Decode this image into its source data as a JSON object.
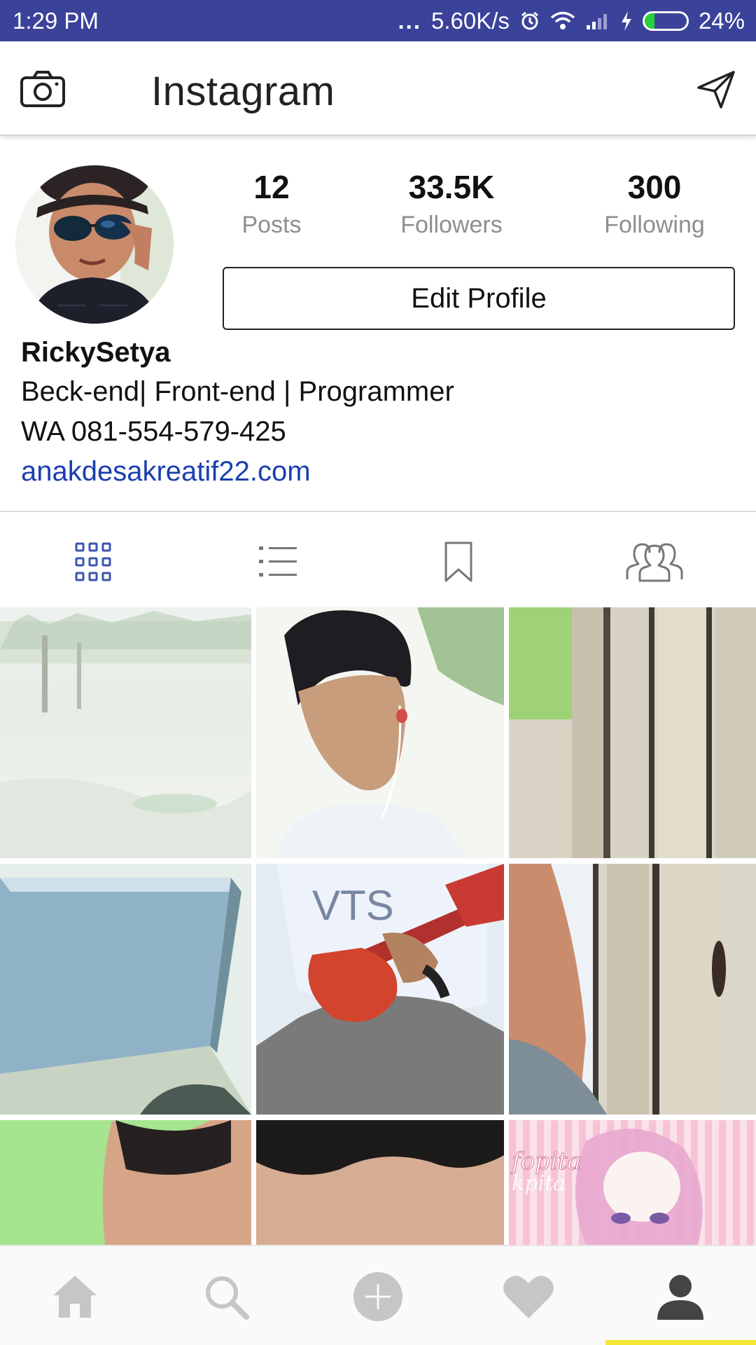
{
  "status_bar": {
    "time": "1:29 PM",
    "dots": "...",
    "network_speed": "5.60K/s",
    "battery_percent": "24%",
    "battery_level": 0.24,
    "icons": [
      "alarm-icon",
      "wifi-icon",
      "signal-icon",
      "charging-icon",
      "battery-icon"
    ]
  },
  "app_bar": {
    "title": "Instagram",
    "left_icon": "camera-icon",
    "right_icon": "direct-send-icon"
  },
  "profile": {
    "stats": [
      {
        "value": "12",
        "label": "Posts"
      },
      {
        "value": "33.5K",
        "label": "Followers"
      },
      {
        "value": "300",
        "label": "Following"
      }
    ],
    "edit_button_label": "Edit Profile",
    "username": "RickySetya",
    "bio_lines": [
      "Beck-end| Front-end | Programmer",
      "WA 081-554-579-425"
    ],
    "website": "anakdesakreatif22.com"
  },
  "tabs": [
    {
      "name": "grid-view-icon",
      "active": true
    },
    {
      "name": "list-view-icon",
      "active": false
    },
    {
      "name": "saved-bookmark-icon",
      "active": false
    },
    {
      "name": "tagged-people-icon",
      "active": false
    }
  ],
  "colors": {
    "status_bar": "#3b429a",
    "active_tab": "#3a55b0",
    "link": "#1a3fb0",
    "inactive_icon": "#bdbdbd"
  },
  "grid_tile_text": {
    "pink_tile_line1": "fopita",
    "pink_tile_line2": "kpita"
  },
  "bottom_nav": [
    {
      "name": "home-icon",
      "active": false
    },
    {
      "name": "search-icon",
      "active": false
    },
    {
      "name": "add-post-icon",
      "active": false
    },
    {
      "name": "activity-heart-icon",
      "active": false
    },
    {
      "name": "profile-icon",
      "active": true
    }
  ]
}
